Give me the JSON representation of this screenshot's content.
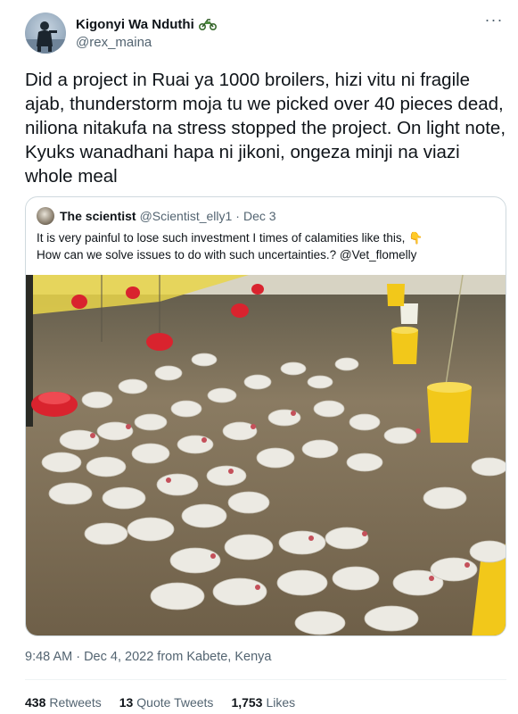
{
  "author": {
    "display_name": "Kigonyi Wa Nduthi",
    "handle": "@rex_maina",
    "badge_icon": "motorcycle-icon"
  },
  "tweet": {
    "text": "Did a project in Ruai ya 1000 broilers, hizi vitu ni fragile ajab, thunderstorm moja tu we picked over 40 pieces dead, niliona nitakufa na stress stopped the project. On light note, Kyuks wanadhani hapa ni jikoni, ongeza minji na viazi whole meal"
  },
  "quote": {
    "display_name": "The scientist",
    "handle": "@Scientist_elly1",
    "separator": "·",
    "date": "Dec 3",
    "text_line1": "It is very painful to lose such investment I times of calamities like this,",
    "emoji_icon": "pointing-down-icon",
    "text_line2": "How can we solve issues to do with such uncertainties.? @Vet_flomelly"
  },
  "meta": {
    "timestamp": "9:48 AM · Dec 4, 2022 from Kabete, Kenya"
  },
  "stats": {
    "retweets_count": "438",
    "retweets_label": "Retweets",
    "quotes_count": "13",
    "quotes_label": "Quote Tweets",
    "likes_count": "1,753",
    "likes_label": "Likes"
  },
  "colors": {
    "text": "#0f1419",
    "secondary": "#536471",
    "border": "#cfd9de",
    "water": "#7d6f5a",
    "feeder_red": "#d9232e",
    "feeder_yellow": "#f2c81a"
  }
}
